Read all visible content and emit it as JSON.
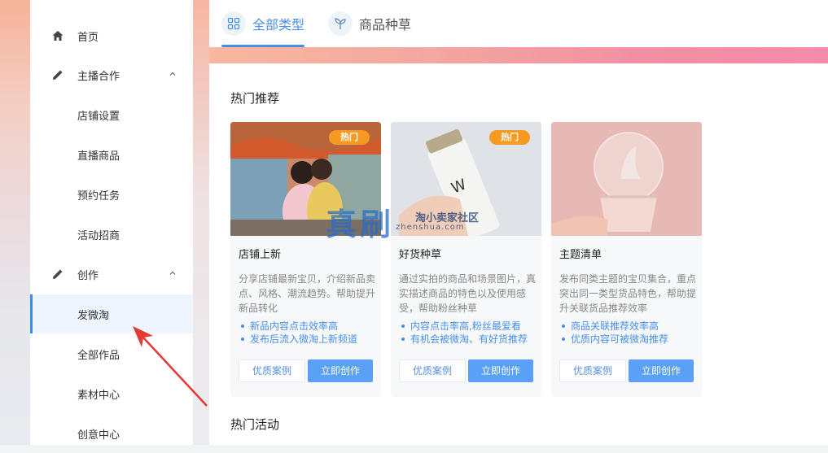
{
  "sidebar": {
    "items": [
      {
        "label": "首页",
        "icon": "home-icon"
      },
      {
        "label": "主播合作",
        "icon": "pencil-icon"
      },
      {
        "label": "店铺设置"
      },
      {
        "label": "直播商品"
      },
      {
        "label": "预约任务"
      },
      {
        "label": "活动招商"
      },
      {
        "label": "创作",
        "icon": "pencil-icon"
      },
      {
        "label": "发微淘"
      },
      {
        "label": "全部作品"
      },
      {
        "label": "素材中心"
      },
      {
        "label": "创意中心"
      }
    ],
    "active": "发微淘"
  },
  "tabs": [
    {
      "label": "全部类型",
      "icon": "grid-icon",
      "active": true
    },
    {
      "label": "商品种草",
      "icon": "sprout-icon",
      "active": false
    }
  ],
  "main": {
    "hot_recommend_title": "热门推荐",
    "hot_activity_title": "热门活动",
    "cards": [
      {
        "badge": "热门",
        "title": "店铺上新",
        "desc": "分享店铺最新宝贝，介绍新品卖点、风格、潮流趋势。帮助提升新品转化",
        "bullets": [
          "新品内容点击效率高",
          "发布后流入微淘上新频道"
        ],
        "case_label": "优质案例",
        "create_label": "立即创作"
      },
      {
        "badge": "热门",
        "title": "好货种草",
        "desc": "通过实拍的商品和场景图片，真实描述商品的特色以及使用感受，帮助粉丝种草",
        "bullets": [
          "内容点击率高,粉丝最爱看",
          "有机会被微淘、有好货推荐"
        ],
        "case_label": "优质案例",
        "create_label": "立即创作"
      },
      {
        "badge": "",
        "title": "主题清单",
        "desc": "发布同类主题的宝贝集合，重点突出同一类型货品特色，帮助提升关联货品推荐效率",
        "bullets": [
          "商品关联推荐效率高",
          "优质内容可被微淘推荐"
        ],
        "case_label": "优质案例",
        "create_label": "立即创作"
      }
    ]
  },
  "watermark": {
    "big": "真刷",
    "small": "淘小卖家社区",
    "url": "zhenshua.com"
  },
  "colors": {
    "accent": "#4a8fe7",
    "badge": "#f59a23",
    "primary_button": "#5aa0f6",
    "arrow": "#e53935"
  }
}
